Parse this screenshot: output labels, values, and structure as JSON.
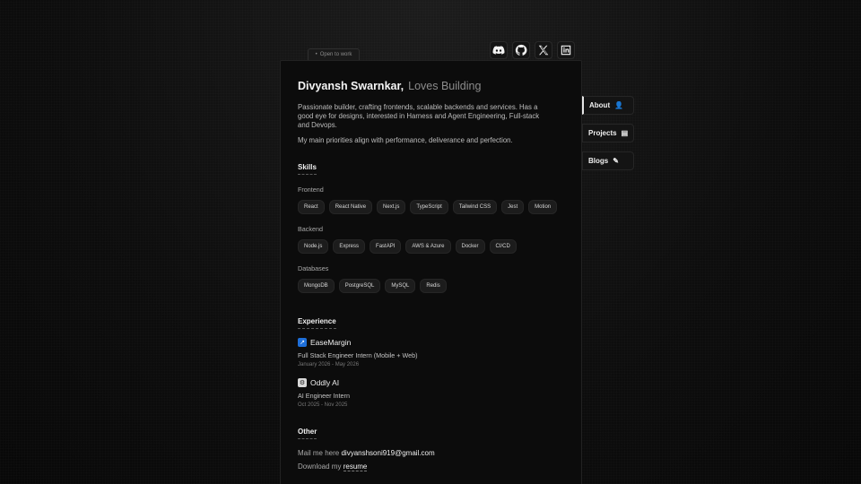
{
  "badge": {
    "dot": "•",
    "label": "Open to work"
  },
  "socials": [
    {
      "name": "discord-icon"
    },
    {
      "name": "github-icon"
    },
    {
      "name": "x-icon"
    },
    {
      "name": "linkedin-icon"
    }
  ],
  "profile": {
    "name": "Divyansh Swarnkar,",
    "tagline": "Loves Building",
    "bio": "Passionate builder, crafting frontends, scalable backends and services. Has a good eye for designs, interested in Harness and Agent Engineering, Full-stack and Devops.",
    "priorities": "My main priorities align with performance, deliverance and perfection."
  },
  "skills": {
    "title": "Skills",
    "groups": [
      {
        "label": "Frontend",
        "items": [
          "React",
          "React Native",
          "Next.js",
          "TypeScript",
          "Tailwind CSS",
          "Jest",
          "Motion"
        ]
      },
      {
        "label": "Backend",
        "items": [
          "Node.js",
          "Express",
          "FastAPI",
          "AWS & Azure",
          "Docker",
          "CI/CD"
        ]
      },
      {
        "label": "Databases",
        "items": [
          "MongoDB",
          "PostgreSQL",
          "MySQL",
          "Redis"
        ]
      }
    ]
  },
  "experience": {
    "title": "Experience",
    "items": [
      {
        "company": "EaseMargin",
        "role": "Full Stack Engineer Intern (Mobile + Web)",
        "date": "January 2026 - May 2026",
        "icon": "↗"
      },
      {
        "company": "Oddly AI",
        "role": "AI Engineer Intern",
        "date": "Oct 2025 - Nov 2025",
        "icon": "⚙"
      }
    ]
  },
  "other": {
    "title": "Other",
    "mail_prefix": "Mail me here",
    "email": "divyanshsoni919@gmail.com",
    "download_prefix": "Download my",
    "resume": "resume"
  },
  "nav": [
    {
      "label": "About",
      "icon": "👤"
    },
    {
      "label": "Projects",
      "icon": "▤"
    },
    {
      "label": "Blogs",
      "icon": "✎"
    }
  ]
}
